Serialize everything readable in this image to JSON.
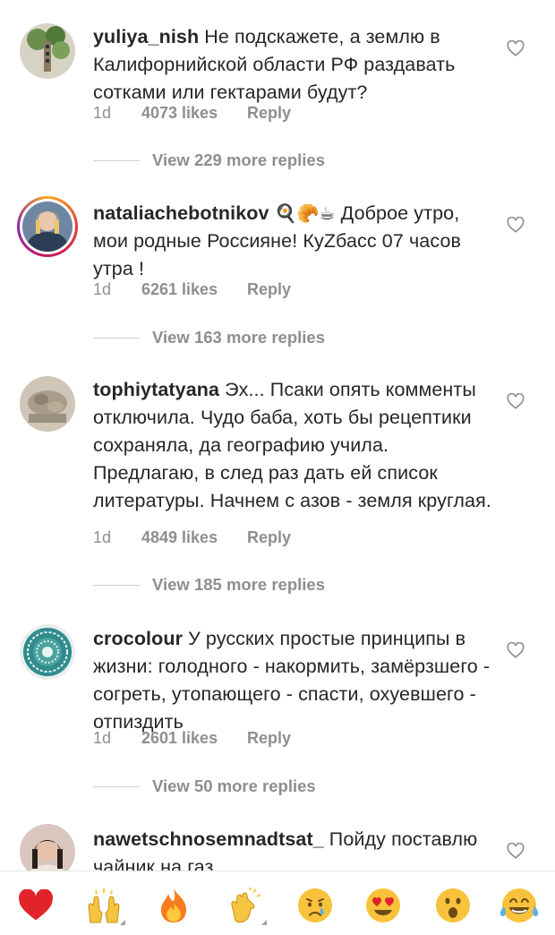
{
  "comments": [
    {
      "username": "yuliya_nish",
      "text": "Не подскажете, а землю в Калифорнийской области РФ раздавать сотками или гектарами будут?",
      "age": "1d",
      "likes": "4073 likes",
      "reply": "Reply",
      "view_replies": "View 229 more replies"
    },
    {
      "username": "nataliachebotnikov",
      "emojis": "🍳🥐☕",
      "text": "Доброе утро, мои родные Россияне! КуZбасс 07 часов утра !",
      "age": "1d",
      "likes": "6261 likes",
      "reply": "Reply",
      "view_replies": "View 163 more replies"
    },
    {
      "username": "tophiytatyana",
      "text": "Эх... Псаки опять комменты отключила. Чудо баба, хоть бы рецептики сохраняла, да географию учила. Предлагаю, в след раз дать ей список литературы. Начнем с азов - земля круглая.",
      "age": "1d",
      "likes": "4849 likes",
      "reply": "Reply",
      "view_replies": "View 185 more replies"
    },
    {
      "username": "crocolour",
      "text": "У русских простые принципы в жизни: голодного - накормить, замёрзшего - согреть, утопающего - спасти, охуевшего - отпиздить",
      "age": "1d",
      "likes": "2601 likes",
      "reply": "Reply",
      "view_replies": "View 50 more replies"
    },
    {
      "username": "nawetschnosemnadtsat_",
      "text": "Пойду поставлю чайник на газ"
    }
  ],
  "reactions": [
    {
      "icon": "red-heart",
      "glyph": "❤️"
    },
    {
      "icon": "raising-hands",
      "glyph": "🙌"
    },
    {
      "icon": "fire",
      "glyph": "🔥"
    },
    {
      "icon": "clapping-hands",
      "glyph": "👏"
    },
    {
      "icon": "crying-face",
      "glyph": "😢"
    },
    {
      "icon": "heart-eyes-face",
      "glyph": "😍"
    },
    {
      "icon": "surprised-face",
      "glyph": "😮"
    },
    {
      "icon": "tears-of-joy-face",
      "glyph": "😂"
    }
  ],
  "colors": {
    "text": "#262626",
    "secondary": "#8e8e8e",
    "story_ring_start": "#f9a825",
    "story_ring_end": "#c2185b"
  }
}
